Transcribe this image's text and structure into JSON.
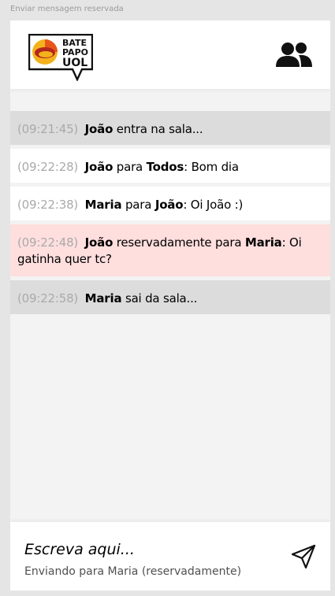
{
  "frame": {
    "label": "Enviar mensagem reservada"
  },
  "header": {
    "logo": {
      "line1": "BATE",
      "line2": "PAPO",
      "line3": "UOL"
    },
    "participants_icon": "people-icon"
  },
  "messages": [
    {
      "type": "status",
      "time": "(09:21:45)",
      "from": "João",
      "text": "entra na sala..."
    },
    {
      "type": "normal",
      "time": "(09:22:28)",
      "from": "João",
      "connector": "para",
      "to": "Todos",
      "text": "Bom dia"
    },
    {
      "type": "normal",
      "time": "(09:22:38)",
      "from": "Maria",
      "connector": "para",
      "to": "João",
      "text": "Oi João :)"
    },
    {
      "type": "private",
      "time": "(09:22:48)",
      "from": "João",
      "connector": "reservadamente para",
      "to": "Maria",
      "text": "Oi gatinha quer tc?"
    },
    {
      "type": "status",
      "time": "(09:22:58)",
      "from": "Maria",
      "text": "sai da sala..."
    }
  ],
  "composer": {
    "placeholder": "Escreva aqui...",
    "sending_to": "Enviando para Maria (reservadamente)",
    "send_icon": "send-icon"
  },
  "colors": {
    "status_bg": "#dcdcdc",
    "normal_bg": "#ffffff",
    "private_bg": "#ffdede",
    "time": "#aaaaaa"
  }
}
